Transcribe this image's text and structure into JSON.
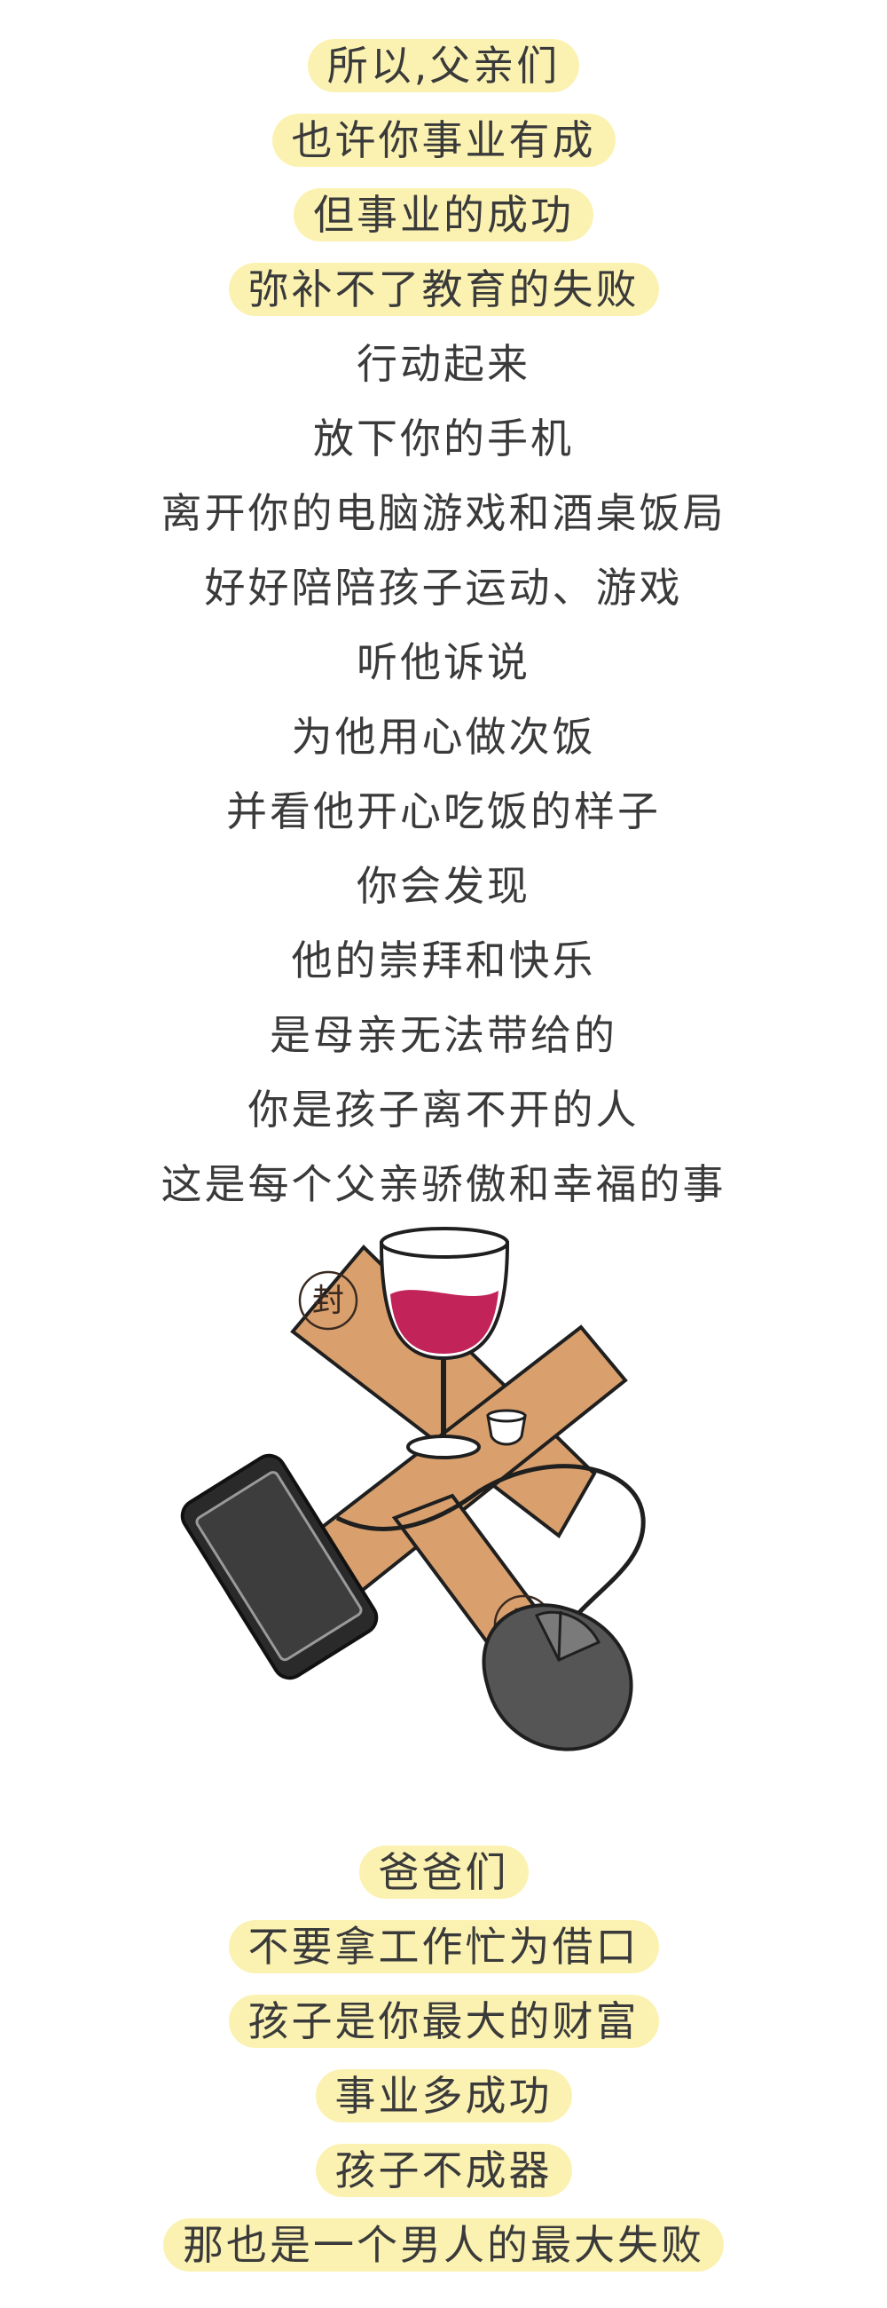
{
  "block_top": {
    "lines": [
      {
        "text": "所以,父亲们",
        "highlight": true
      },
      {
        "text": "也许你事业有成",
        "highlight": true
      },
      {
        "text": "但事业的成功",
        "highlight": true
      },
      {
        "text": "弥补不了教育的失败",
        "highlight": true
      },
      {
        "text": "行动起来",
        "highlight": false
      },
      {
        "text": "放下你的手机",
        "highlight": false
      },
      {
        "text": "离开你的电脑游戏和酒桌饭局",
        "highlight": false
      },
      {
        "text": "好好陪陪孩子运动、游戏",
        "highlight": false
      },
      {
        "text": "听他诉说",
        "highlight": false
      },
      {
        "text": "为他用心做次饭",
        "highlight": false
      },
      {
        "text": "并看他开心吃饭的样子",
        "highlight": false
      },
      {
        "text": "你会发现",
        "highlight": false
      },
      {
        "text": "他的崇拜和快乐",
        "highlight": false
      },
      {
        "text": "是母亲无法带给的",
        "highlight": false
      },
      {
        "text": "你是孩子离不开的人",
        "highlight": false
      },
      {
        "text": "这是每个父亲骄傲和幸福的事",
        "highlight": false
      }
    ]
  },
  "illustration": {
    "seal_char": "封",
    "icons": [
      "cross-seal-strips-icon",
      "wine-glass-icon",
      "small-cup-icon",
      "smartphone-icon",
      "computer-mouse-icon"
    ],
    "colors": {
      "strip": "#d9a06e",
      "wine": "#c2245a",
      "phone": "#2a2a2a",
      "mouse": "#555555"
    }
  },
  "block_bottom": {
    "lines": [
      {
        "text": "爸爸们",
        "highlight": true
      },
      {
        "text": "不要拿工作忙为借口",
        "highlight": true
      },
      {
        "text": "孩子是你最大的财富",
        "highlight": true
      },
      {
        "text": "事业多成功",
        "highlight": true
      },
      {
        "text": "孩子不成器",
        "highlight": true
      },
      {
        "text": "那也是一个男人的最大失败",
        "highlight": true
      }
    ]
  },
  "colors": {
    "text": "#3a3a3a",
    "highlight": "#fbf2b2"
  }
}
